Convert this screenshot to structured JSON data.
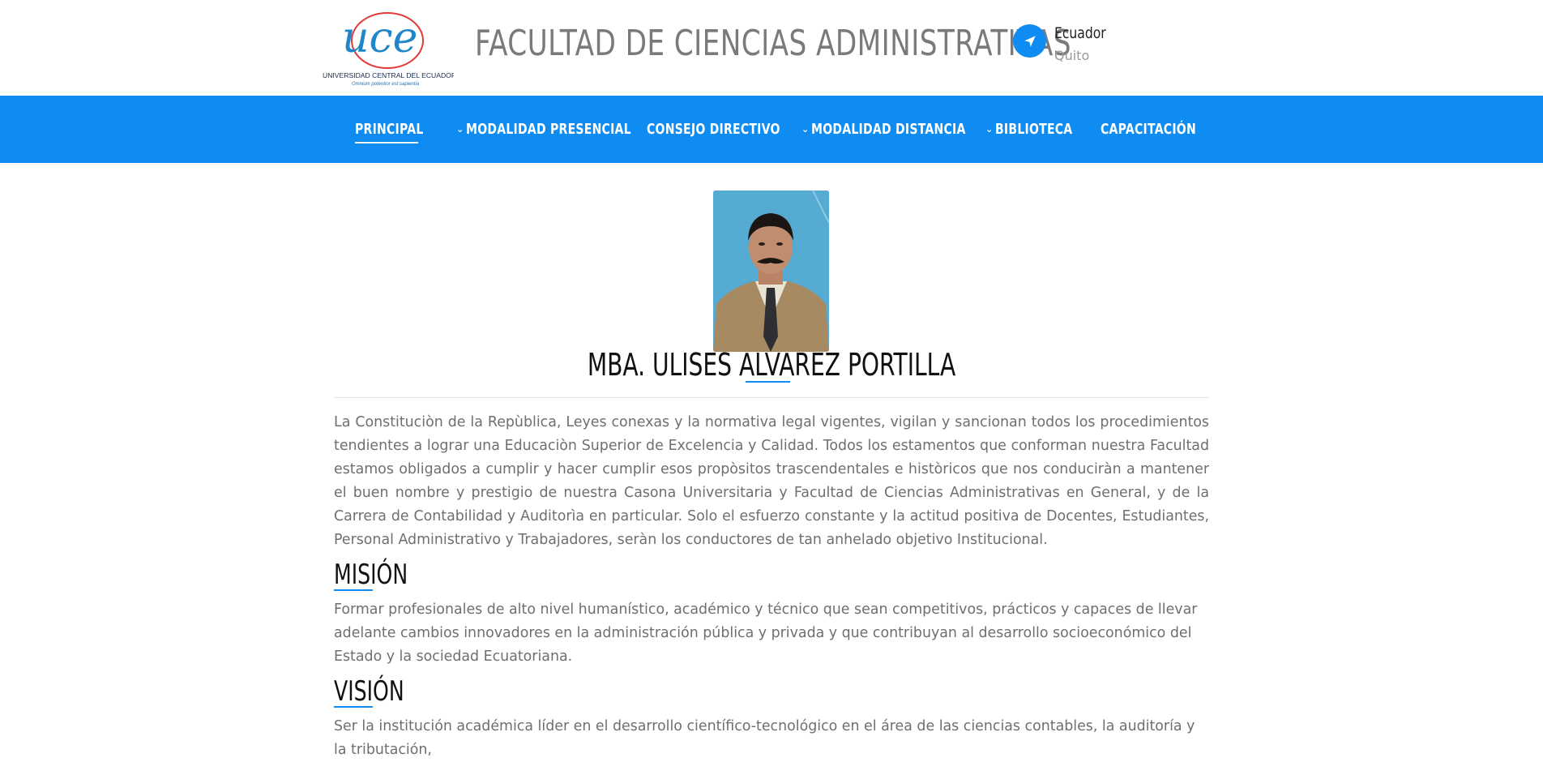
{
  "header": {
    "logo_text": "UCE",
    "logo_university": "UNIVERSIDAD CENTRAL DEL ECUADOR",
    "logo_motto": "Omnium potentior est sapientia",
    "site_title": "FACULTAD DE CIENCIAS ADMINISTRATIVAS",
    "location_country": "Ecuador",
    "location_city": "Quito",
    "location_icon": "navigation-arrow-icon"
  },
  "nav": {
    "items": [
      {
        "label": "PRINCIPAL",
        "dropdown": false,
        "active": true
      },
      {
        "label": "MODALIDAD PRESENCIAL",
        "dropdown": true,
        "active": false
      },
      {
        "label": "CONSEJO DIRECTIVO",
        "dropdown": false,
        "active": false
      },
      {
        "label": "MODALIDAD DISTANCIA",
        "dropdown": true,
        "active": false
      },
      {
        "label": "BIBLIOTECA",
        "dropdown": true,
        "active": false
      },
      {
        "label": "CAPACITACIÓN",
        "dropdown": false,
        "active": false
      }
    ]
  },
  "profile": {
    "name": "MBA. ULISES ALVAREZ PORTILLA",
    "intro": "La Constituciòn de la Repùblica, Leyes conexas y la normativa legal vigentes, vigilan y sancionan todos los procedimientos tendientes a lograr una Educaciòn Superior de Excelencia y Calidad. Todos los estamentos que conforman nuestra Facultad estamos obligados a cumplir y hacer cumplir esos propòsitos trascendentales e històricos que nos conduciràn a mantener el buen nombre y prestigio de nuestra Casona Universitaria y Facultad de Ciencias Administrativas en General, y de la Carrera de Contabilidad y Auditorìa en particular. Solo el esfuerzo constante y la actitud positiva de Docentes, Estudiantes, Personal Administrativo y Trabajadores, seràn los conductores de tan anhelado objetivo Institucional."
  },
  "mision": {
    "title": "MISIÓN",
    "text": "Formar profesionales de alto nivel humanístico, académico y técnico que sean competitivos, prácticos y capaces de llevar adelante cambios innovadores en la administración pública y privada y que contribuyan al desarrollo socioeconómico del Estado y la sociedad Ecuatoriana."
  },
  "vision": {
    "title": "VISIÓN",
    "text": "Ser la institución académica líder en el desarrollo científico-tecnológico en el área de las ciencias contables, la auditoría y la tributación,"
  },
  "colors": {
    "accent": "#0e8cf1",
    "title_gray": "#7a7a7a",
    "body_text": "#6f6f6f"
  }
}
